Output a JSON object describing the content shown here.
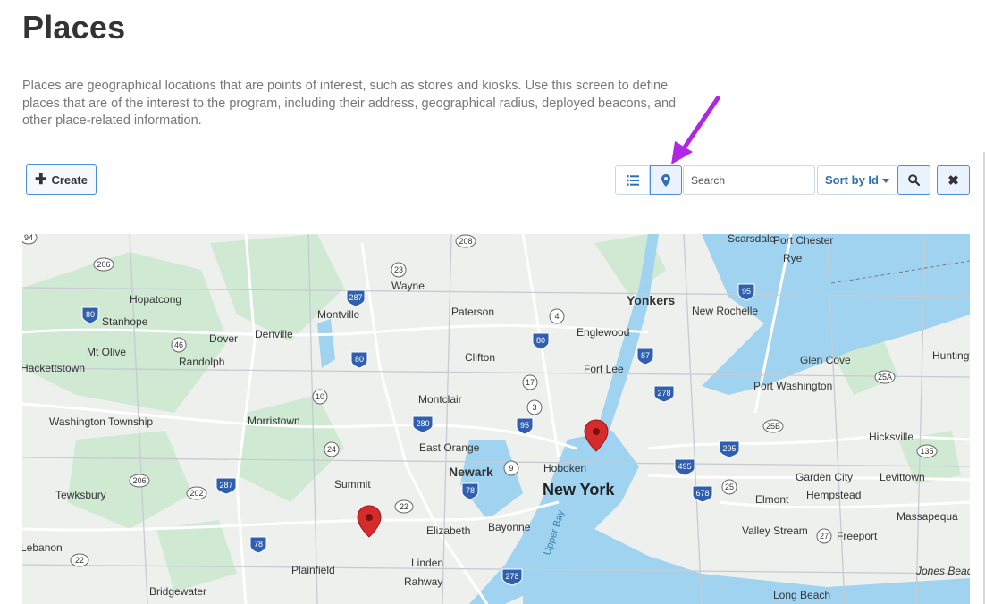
{
  "page": {
    "title": "Places",
    "description": "Places are geographical locations that are points of interest, such as stores and kiosks. Use this screen to define places that are of the interest to the program, including their address, geographical radius, deployed beacons, and other place-related information."
  },
  "toolbar": {
    "create_label": "Create",
    "search_placeholder": "Search",
    "sort_label": "Sort by Id",
    "icons": {
      "create": "plus-icon",
      "list_view": "list-icon",
      "map_view": "map-marker-icon",
      "search": "search-icon",
      "clear": "close-icon",
      "sort": "caret-down-icon"
    }
  },
  "annotation": {
    "arrow_color": "#b026e6"
  },
  "colors": {
    "accent": "#2e6fb5",
    "marker": "#d42b2b",
    "water": "#9fd3f0",
    "park": "#cfe9d3",
    "interstate_shield": "#2f5fae"
  },
  "map": {
    "cities": [
      {
        "name": "Scarsdale"
      },
      {
        "name": "Port Chester"
      },
      {
        "name": "Rye"
      },
      {
        "name": "Hopatcong"
      },
      {
        "name": "Wayne"
      },
      {
        "name": "Stanhope"
      },
      {
        "name": "Montville"
      },
      {
        "name": "Paterson"
      },
      {
        "name": "Yonkers"
      },
      {
        "name": "New Rochelle"
      },
      {
        "name": "Dover"
      },
      {
        "name": "Denville"
      },
      {
        "name": "Englewood"
      },
      {
        "name": "Mt Olive"
      },
      {
        "name": "Randolph"
      },
      {
        "name": "Clifton"
      },
      {
        "name": "Fort Lee"
      },
      {
        "name": "Glen Cove"
      },
      {
        "name": "Huntington"
      },
      {
        "name": "Hackettstown"
      },
      {
        "name": "Montclair"
      },
      {
        "name": "Port Washington"
      },
      {
        "name": "Washington Township"
      },
      {
        "name": "Morristown"
      },
      {
        "name": "East Orange"
      },
      {
        "name": "Hicksville"
      },
      {
        "name": "Newark"
      },
      {
        "name": "Hoboken"
      },
      {
        "name": "New York"
      },
      {
        "name": "Tewksbury"
      },
      {
        "name": "Summit"
      },
      {
        "name": "Garden City"
      },
      {
        "name": "Levittown"
      },
      {
        "name": "Hempstead"
      },
      {
        "name": "Elmont"
      },
      {
        "name": "Massapequa"
      },
      {
        "name": "Elizabeth"
      },
      {
        "name": "Bayonne"
      },
      {
        "name": "Valley Stream"
      },
      {
        "name": "Freeport"
      },
      {
        "name": "Lebanon"
      },
      {
        "name": "Plainfield"
      },
      {
        "name": "Linden"
      },
      {
        "name": "Bridgewater"
      },
      {
        "name": "Rahway"
      },
      {
        "name": "Long Beach"
      },
      {
        "name": "Jones Beach Island"
      },
      {
        "name": "Upper Bay"
      }
    ],
    "route_shields": [
      "94",
      "206",
      "208",
      "23",
      "287",
      "95",
      "80",
      "4",
      "46",
      "87",
      "10",
      "17",
      "3",
      "278",
      "280",
      "25A",
      "25B",
      "295",
      "135",
      "24",
      "9",
      "495",
      "206",
      "202",
      "287",
      "78",
      "678",
      "25",
      "22",
      "78",
      "27",
      "22",
      "278"
    ],
    "markers": [
      {
        "label": "marker-manhattan"
      },
      {
        "label": "marker-summit"
      }
    ]
  }
}
